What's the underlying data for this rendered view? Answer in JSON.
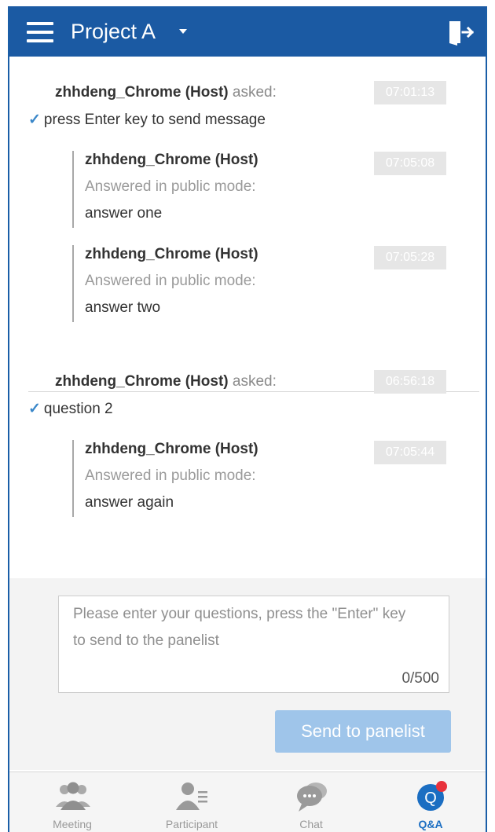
{
  "header": {
    "title": "Project A"
  },
  "questions": [
    {
      "author": "zhhdeng_Chrome (Host)",
      "asked": "asked:",
      "time": "07:01:13",
      "text": "press Enter key to send message",
      "answers": [
        {
          "author": "zhhdeng_Chrome (Host)",
          "mode": "Answered in public mode:",
          "time": "07:05:08",
          "text": "answer one"
        },
        {
          "author": "zhhdeng_Chrome (Host)",
          "mode": "Answered in public mode:",
          "time": "07:05:28",
          "text": "answer two"
        }
      ]
    },
    {
      "author": "zhhdeng_Chrome (Host)",
      "asked": "asked:",
      "time": "06:56:18",
      "text": "question 2",
      "answers": [
        {
          "author": "zhhdeng_Chrome (Host)",
          "mode": "Answered in public mode:",
          "time": "07:05:44",
          "text": "answer again"
        }
      ]
    }
  ],
  "input": {
    "placeholder": "Please enter your questions, press the \"Enter\" key to send to the panelist",
    "counter": "0/500",
    "send_label": "Send to panelist"
  },
  "tabs": [
    {
      "label": "Meeting",
      "icon": "meeting-icon"
    },
    {
      "label": "Participant",
      "icon": "participant-icon"
    },
    {
      "label": "Chat",
      "icon": "chat-icon"
    },
    {
      "label": "Q&A",
      "icon": "qa-icon",
      "active": true
    }
  ],
  "colors": {
    "header": "#1b5aa3",
    "accent": "#1b6ec2",
    "send_button": "#9fc5ea",
    "notification_dot": "#e8323c"
  }
}
